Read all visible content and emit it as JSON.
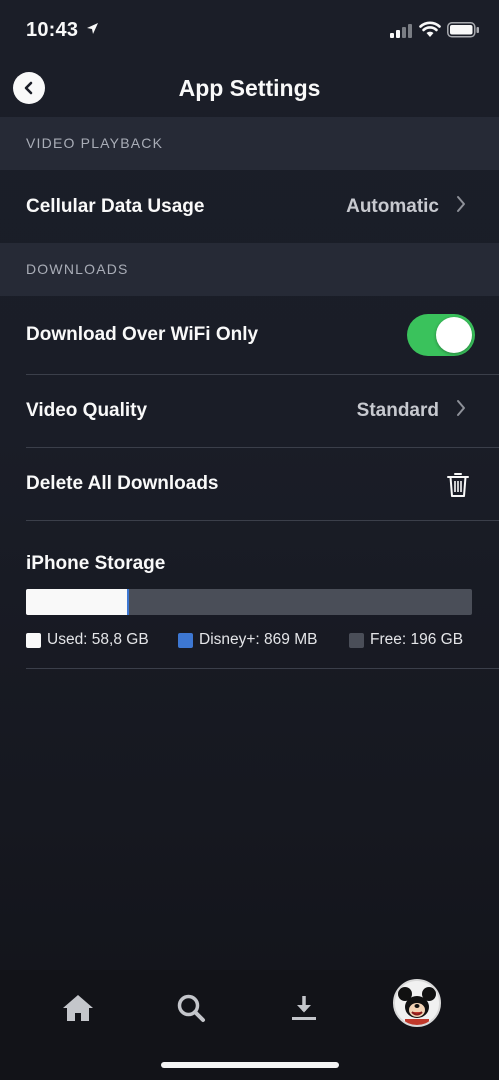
{
  "status_bar": {
    "time": "10:43"
  },
  "nav": {
    "title": "App Settings"
  },
  "sections": {
    "video_playback": {
      "header": "VIDEO PLAYBACK",
      "cellular_label": "Cellular Data Usage",
      "cellular_value": "Automatic"
    },
    "downloads": {
      "header": "DOWNLOADS",
      "wifi_only_label": "Download Over WiFi Only",
      "wifi_only_enabled": true,
      "video_quality_label": "Video Quality",
      "video_quality_value": "Standard",
      "delete_label": "Delete All Downloads"
    }
  },
  "storage": {
    "title": "iPhone Storage",
    "used_fraction": 0.227,
    "disney_fraction": 0.004,
    "legend": {
      "used": "Used: 58,8 GB",
      "disney": "Disney+: 869 MB",
      "free": "Free: 196 GB"
    },
    "colors": {
      "used": "#f9f9f9",
      "disney": "#3d77d2",
      "free": "#4a4e58"
    }
  },
  "tab_bar": {
    "items": [
      "home-icon",
      "search-icon",
      "downloads-icon",
      "profile-avatar"
    ]
  },
  "colors": {
    "accent_toggle": "#3ac25c",
    "section_bg": "#262a36"
  }
}
